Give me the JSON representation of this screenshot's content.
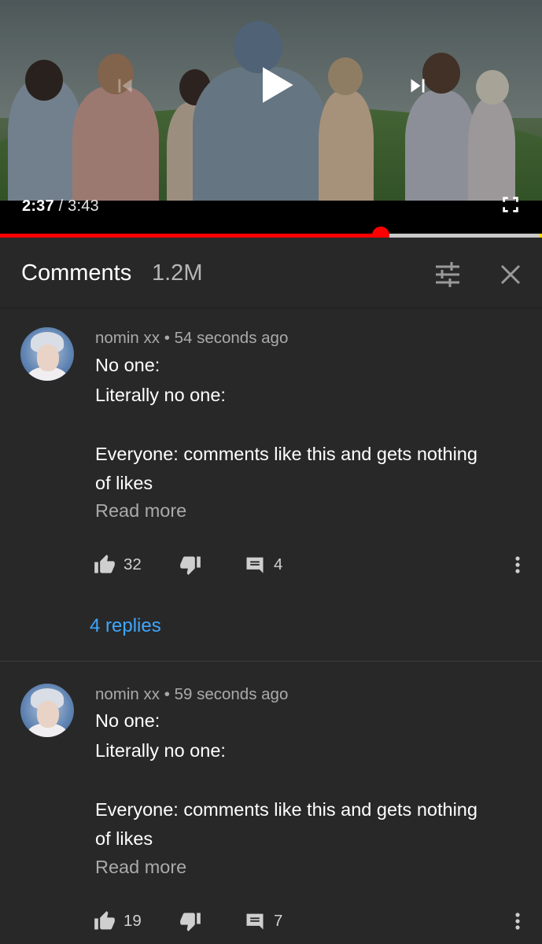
{
  "player": {
    "current_time": "2:37",
    "separator": " / ",
    "duration": "3:43",
    "progress_fraction": 0.703
  },
  "comments_header": {
    "title": "Comments",
    "count": "1.2M"
  },
  "comments": [
    {
      "author": "nomin xx",
      "dot": " • ",
      "time": "54 seconds ago",
      "lines": [
        "No one:",
        "Literally no one:",
        "",
        "Everyone: comments like this and gets nothing",
        "of likes"
      ],
      "read_more": "Read more",
      "likes": "32",
      "reply_count": "4",
      "replies_link": "4 replies"
    },
    {
      "author": "nomin xx",
      "dot": " • ",
      "time": "59 seconds ago",
      "lines": [
        "No one:",
        "Literally no one:",
        "",
        "Everyone: comments like this and gets nothing",
        "of likes"
      ],
      "read_more": "Read more",
      "likes": "19",
      "reply_count": "7"
    }
  ],
  "colors": {
    "background": "#282828",
    "progress_played": "#ff0000",
    "link": "#3ea6ff",
    "secondary_text": "#aaaaaa"
  },
  "icons": [
    "previous-icon",
    "play-icon",
    "next-icon",
    "fullscreen-icon",
    "filter-icon",
    "close-icon",
    "thumb-up-icon",
    "thumb-down-icon",
    "comment-icon",
    "more-vert-icon"
  ]
}
